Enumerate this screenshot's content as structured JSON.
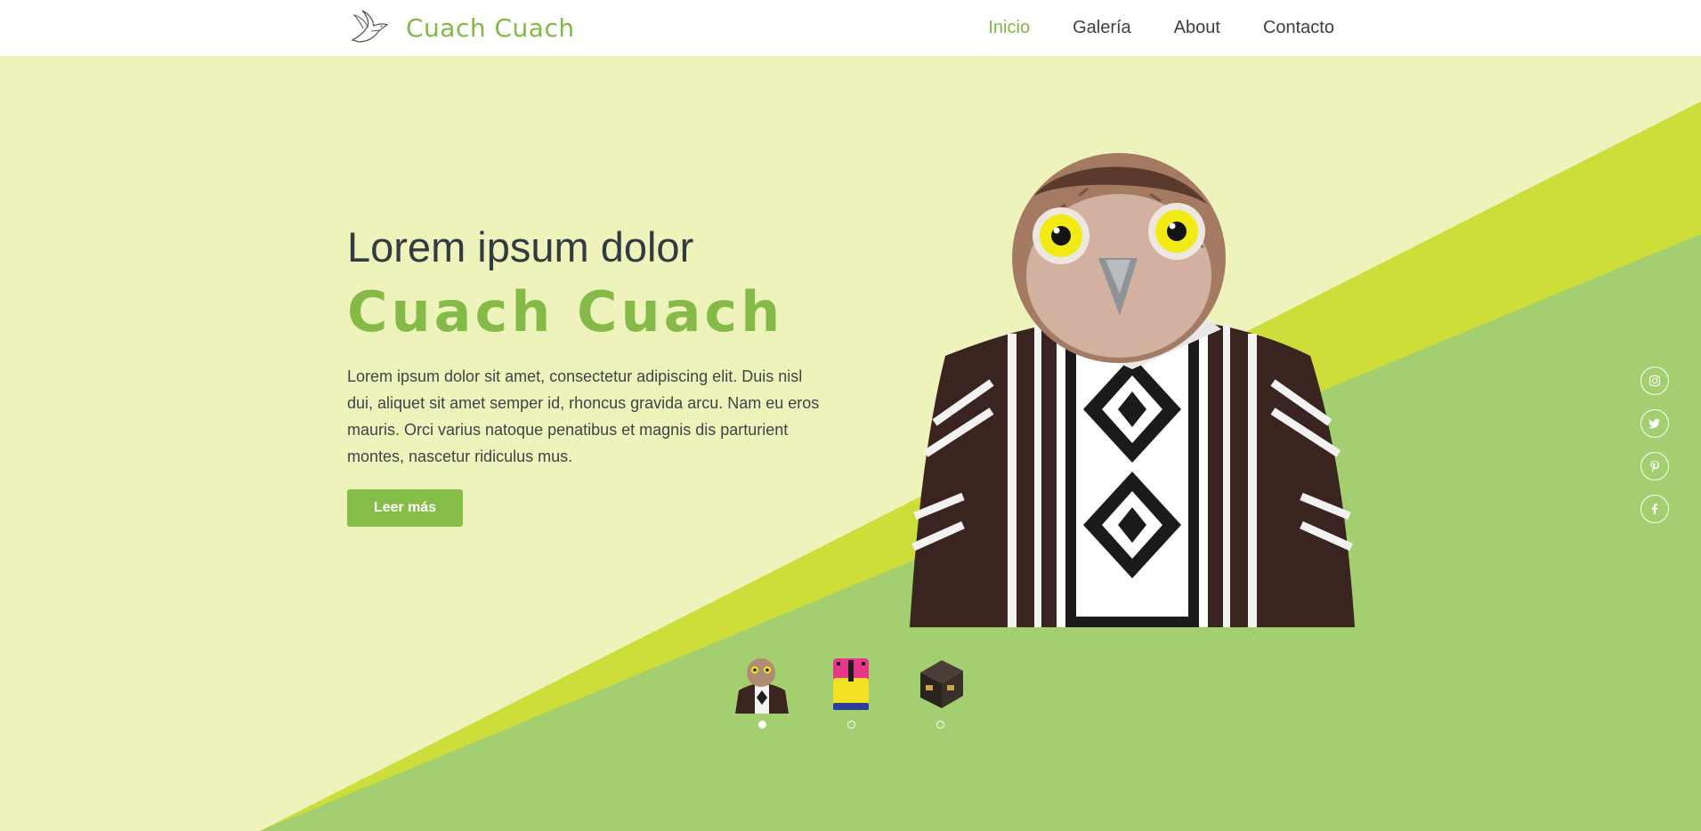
{
  "brand": {
    "name": "Cuach Cuach",
    "logo_icon": "dove-icon"
  },
  "nav": {
    "items": [
      {
        "label": "Inicio",
        "active": true
      },
      {
        "label": "Galería",
        "active": false
      },
      {
        "label": "About",
        "active": false
      },
      {
        "label": "Contacto",
        "active": false
      }
    ]
  },
  "hero": {
    "title": "Lorem ipsum dolor",
    "brand": "Cuach Cuach",
    "description": "Lorem ipsum dolor sit amet, consectetur adipiscing elit. Duis nisl dui, aliquet sit amet semper id, rhoncus gravida arcu. Nam eu eros mauris. Orci varius natoque penatibus et magnis dis parturient montes, nascetur ridiculus mus.",
    "button_label": "Leer más",
    "image_subject": "owl-in-poncho-illustration"
  },
  "carousel": {
    "thumbnails": [
      {
        "subject": "owl-poncho-thumbnail",
        "active": true
      },
      {
        "subject": "backpack-thumbnail",
        "active": false
      },
      {
        "subject": "dark-box-thumbnail",
        "active": false
      }
    ]
  },
  "social": [
    {
      "icon": "instagram-icon"
    },
    {
      "icon": "twitter-icon"
    },
    {
      "icon": "pinterest-icon"
    },
    {
      "icon": "facebook-icon"
    }
  ],
  "colors": {
    "brand_green": "#82b845",
    "background_pale": "#eef3bc",
    "diagonal_lime": "#cddd3a",
    "diagonal_green": "#a4cf70",
    "text_dark": "#333a40"
  }
}
